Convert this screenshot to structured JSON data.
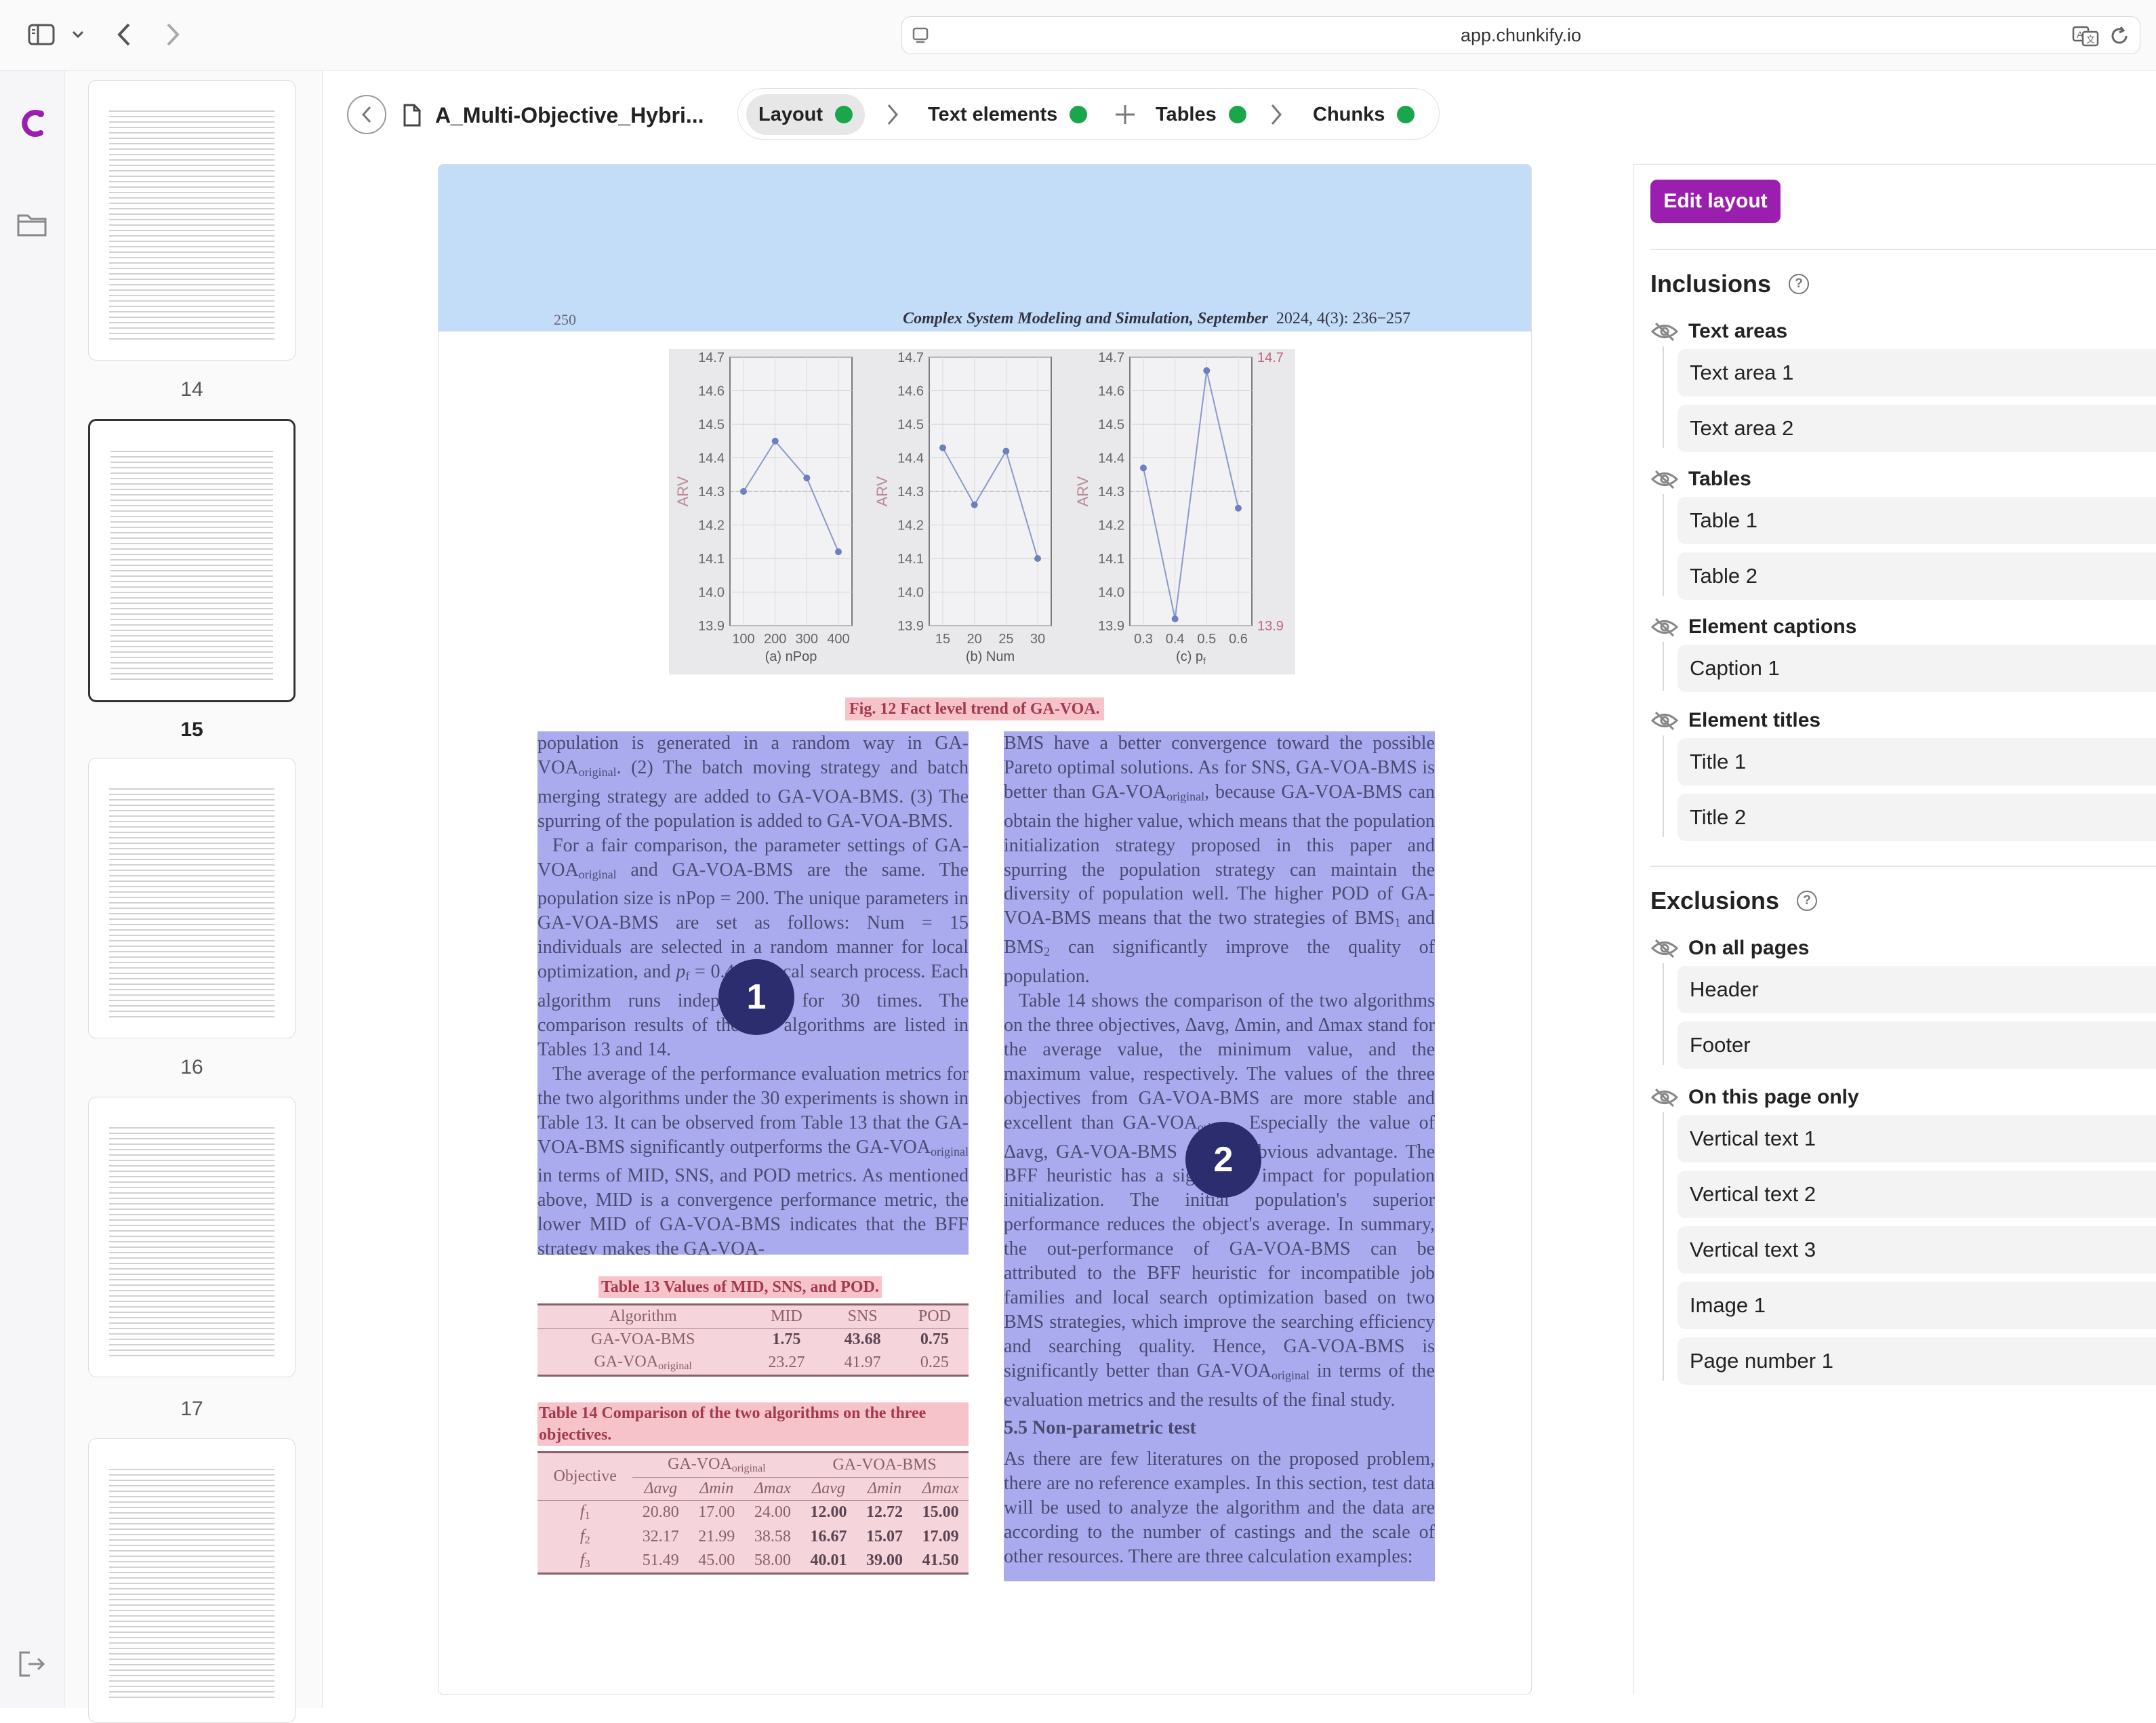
{
  "browser": {
    "url": "app.chunkify.io"
  },
  "thumbnails": [
    {
      "page": "14",
      "active": false
    },
    {
      "page": "15",
      "active": true
    },
    {
      "page": "16",
      "active": false
    },
    {
      "page": "17",
      "active": false
    },
    {
      "page": "",
      "active": false
    }
  ],
  "toolbar": {
    "doc_title": "A_Multi-Objective_Hybri...",
    "steps": [
      {
        "label": "Layout",
        "status": "done"
      },
      {
        "label": "Text elements",
        "status": "done"
      },
      {
        "label": "Tables",
        "status": "done"
      },
      {
        "label": "Chunks",
        "status": "done"
      }
    ],
    "status_color": "#1aa64a"
  },
  "document": {
    "header": {
      "page_number": "250",
      "journal": "Complex System Modeling and Simulation, September",
      "issue": "2024, 4(3): 236−257"
    },
    "figure_caption": "Fig. 12   Fact level trend of GA-VOA.",
    "chart_data": [
      {
        "type": "line",
        "x": [
          100,
          200,
          300,
          400
        ],
        "xtick_labels": [
          "100",
          "200",
          "300",
          "400"
        ],
        "values": [
          14.3,
          14.45,
          14.34,
          14.12
        ],
        "xlabel": "(a) nPop",
        "ylabel": "ARV",
        "ylim": [
          13.9,
          14.7
        ],
        "yticks": [
          "13.9",
          "14.0",
          "14.1",
          "14.2",
          "14.3",
          "14.4",
          "14.5",
          "14.6",
          "14.7"
        ]
      },
      {
        "type": "line",
        "x": [
          15,
          20,
          25,
          30
        ],
        "xtick_labels": [
          "15",
          "20",
          "25",
          "30"
        ],
        "values": [
          14.43,
          14.26,
          14.42,
          14.1
        ],
        "xlabel": "(b) Num",
        "ylabel": "ARV",
        "ylim": [
          13.9,
          14.7
        ],
        "yticks": [
          "13.9",
          "14.0",
          "14.1",
          "14.2",
          "14.3",
          "14.4",
          "14.5",
          "14.6",
          "14.7"
        ]
      },
      {
        "type": "line",
        "x": [
          0.3,
          0.4,
          0.5,
          0.6
        ],
        "xtick_labels": [
          "0.3",
          "0.4",
          "0.5",
          "0.6"
        ],
        "values": [
          14.37,
          13.92,
          14.66,
          14.25
        ],
        "xlabel": "(c) p",
        "xlabel_sub": "f",
        "ylabel": "ARV",
        "ylim": [
          13.9,
          14.7
        ],
        "yticks": [
          "13.9",
          "14.0",
          "14.1",
          "14.2",
          "14.3",
          "14.4",
          "14.5",
          "14.6",
          "14.7"
        ],
        "right_labels": [
          "14.7",
          "13.9"
        ]
      }
    ],
    "area1_badge": "1",
    "area2_badge": "2",
    "col1": {
      "p1a": "population is generated in a random way in GA-VOA",
      "p1sub": "original",
      "p1b": ". (2) The batch moving strategy and batch merging strategy are added to GA-VOA-BMS. (3) The spurring of the population is added to GA-VOA-BMS.",
      "p2a": "For a fair comparison, the parameter settings of GA-VOA",
      "p2sub": "original",
      "p2b": " and GA-VOA-BMS are the same. The population size is nPop = 200. The unique parameters in GA-VOA-BMS are set as follows: Num = 15 individuals are selected in a random manner for local optimization, and ",
      "p2pf": "p",
      "p2pfsub": "f",
      "p2c": " = 0.4 the local search process. Each algorithm runs independently for 30 times. The comparison results of the two algorithms are listed in Tables 13 and 14.",
      "p3a": "The average of the performance evaluation metrics for the two algorithms under the 30 experiments is shown in Table 13. It can be observed from Table 13 that the GA-VOA-BMS significantly outperforms the GA-VOA",
      "p3sub": "original",
      "p3b": " in terms of MID, SNS, and POD metrics. As mentioned above, MID is a convergence performance metric, the lower MID of GA-VOA-BMS indicates that the BFF strategy makes the GA-VOA-"
    },
    "table13": {
      "title": "Table 13   Values of MID, SNS, and POD.",
      "headers": [
        "Algorithm",
        "MID",
        "SNS",
        "POD"
      ],
      "rows": [
        {
          "alg": "GA-VOA-BMS",
          "alg_sub": "",
          "mid": "1.75",
          "sns": "43.68",
          "pod": "0.75"
        },
        {
          "alg": "GA-VOA",
          "alg_sub": "original",
          "mid": "23.27",
          "sns": "41.97",
          "pod": "0.25"
        }
      ]
    },
    "table14": {
      "title": "Table 14   Comparison of the two algorithms on the three objectives.",
      "header_objective": "Objective",
      "group1": "GA-VOA",
      "group1_sub": "original",
      "group2": "GA-VOA-BMS",
      "subheaders": [
        "Δavg",
        "Δmin",
        "Δmax",
        "Δavg",
        "Δmin",
        "Δmax"
      ],
      "rows": [
        {
          "obj": "f",
          "obj_sub": "1",
          "v": [
            "20.80",
            "17.00",
            "24.00",
            "12.00",
            "12.72",
            "15.00"
          ]
        },
        {
          "obj": "f",
          "obj_sub": "2",
          "v": [
            "32.17",
            "21.99",
            "38.58",
            "16.67",
            "15.07",
            "17.09"
          ]
        },
        {
          "obj": "f",
          "obj_sub": "3",
          "v": [
            "51.49",
            "45.00",
            "58.00",
            "40.01",
            "39.00",
            "41.50"
          ]
        }
      ]
    },
    "col2": {
      "p1a": "BMS have a better convergence toward the possible Pareto optimal solutions. As for SNS, GA-VOA-BMS is better than GA-VOA",
      "p1sub": "original",
      "p1b": ", because GA-VOA-BMS can obtain the higher value, which means that the population initialization strategy proposed in this paper and spurring the population strategy can maintain the diversity of population well. The higher POD of GA-VOA-BMS means that the two strategies of BMS",
      "p1s1": "1",
      "p1c": " and BMS",
      "p1s2": "2",
      "p1d": " can significantly improve the quality of population.",
      "p2a": "Table 14 shows the comparison of the two algorithms on the three objectives, Δavg, Δmin, and Δmax stand for the average value, the minimum value, and the maximum value, respectively. The values of the three objectives from GA-VOA-BMS are more stable and excellent than GA-VOA",
      "p2sub": "original",
      "p2b": ". Especially the value of Δavg, GA-VOA-BMS got the obvious advantage. The BFF heuristic has a significant impact for population initialization. The initial population's superior performance reduces the object's average. In summary, the out-performance of GA-VOA-BMS can be attributed to the BFF heuristic for incompatible job families and local search optimization based on two BMS strategies, which improve the searching efficiency and searching quality. Hence, GA-VOA-BMS is significantly better than GA-VOA",
      "p2sub2": "original",
      "p2c": " in terms of the evaluation metrics and the results of the final study.",
      "heading": "5.5    Non-parametric test",
      "p3": "As there are few literatures on the proposed problem, there are no reference examples. In this section, test data will be used to analyze the algorithm and the data are according to the number of castings and the scale of other resources. There are three calculation examples:"
    }
  },
  "panel": {
    "edit_button": "Edit layout",
    "accent": "#9b1fae",
    "inclusions": {
      "title": "Inclusions",
      "groups": [
        {
          "label": "Text areas",
          "items": [
            "Text area 1",
            "Text area 2"
          ]
        },
        {
          "label": "Tables",
          "items": [
            "Table 1",
            "Table 2"
          ]
        },
        {
          "label": "Element captions",
          "items": [
            "Caption 1"
          ]
        },
        {
          "label": "Element titles",
          "items": [
            "Title 1",
            "Title 2"
          ]
        }
      ]
    },
    "exclusions": {
      "title": "Exclusions",
      "groups": [
        {
          "label": "On all pages",
          "items": [
            "Header",
            "Footer"
          ]
        },
        {
          "label": "On this page only",
          "items": [
            "Vertical text 1",
            "Vertical text 2",
            "Vertical text 3",
            "Image 1",
            "Page number 1"
          ]
        }
      ]
    }
  }
}
